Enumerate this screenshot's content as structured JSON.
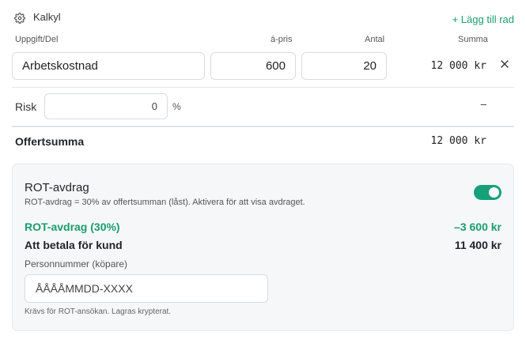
{
  "header": {
    "title": "Kalkyl",
    "icon": "gear-icon",
    "add_row_label": "+ Lägg till rad"
  },
  "columns": {
    "task": "Uppgift/Del",
    "price": "á-pris",
    "qty": "Antal",
    "sum": "Summa"
  },
  "rows": [
    {
      "task": "Arbetskostnad",
      "price": "600",
      "qty": "20",
      "sum": "12 000 kr"
    }
  ],
  "risk": {
    "label": "Risk",
    "value": "0",
    "unit": "%",
    "sum": "–"
  },
  "offer": {
    "label": "Offertsumma",
    "sum": "12 000 kr"
  },
  "rot": {
    "title": "ROT-avdrag",
    "description": "ROT-avdrag = 30% av offertsumman (låst). Aktivera för att visa avdraget.",
    "enabled": true,
    "deduction_label": "ROT-avdrag (30%)",
    "deduction_amount": "–3 600 kr",
    "pay_label": "Att betala för kund",
    "pay_amount": "11 400 kr",
    "personnummer_label": "Personnummer (köpare)",
    "personnummer_placeholder": "ÅÅÅÅMMDD-XXXX",
    "hint": "Krävs för ROT-ansökan. Lagras krypterat."
  },
  "colors": {
    "accent": "#1a9e6b",
    "toggle_on": "#16a07a"
  }
}
